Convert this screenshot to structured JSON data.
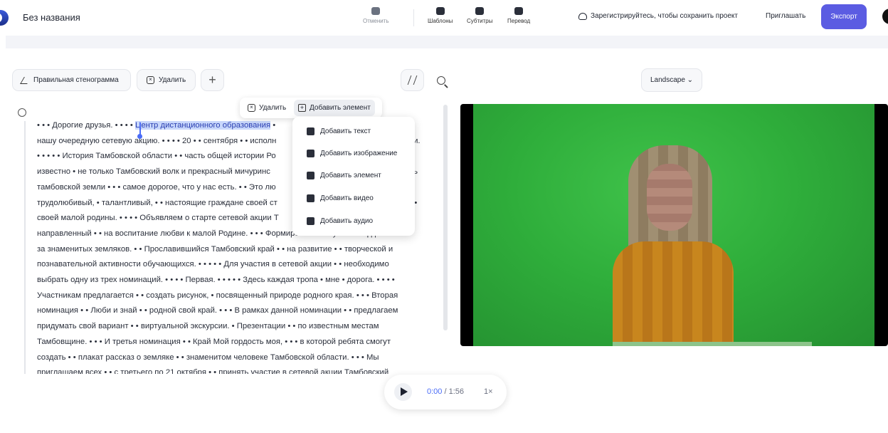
{
  "header": {
    "title": "Без названия",
    "undo_label": "Отменить",
    "templates_label": "Шаблоны",
    "subtitles_label": "Субтитры",
    "translate_label": "Перевод",
    "signup_label": "Зарегистрируйтесь, чтобы сохранить проект",
    "invite_label": "Приглашать",
    "export_label": "Экспорт",
    "accent_color": "#5b5ce2"
  },
  "toolbar": {
    "transcript_label": "Правильная стенограмма",
    "delete_label": "Удалить",
    "plus_label": "+",
    "aspect_label": "Landscape ⌄"
  },
  "context_menu": {
    "delete_label": "Удалить",
    "add_element_label": "Добавить элемент",
    "items": [
      {
        "label": "Добавить текст",
        "icon": "text-icon"
      },
      {
        "label": "Добавить изображение",
        "icon": "image-icon"
      },
      {
        "label": "Добавить элемент",
        "icon": "element-icon"
      },
      {
        "label": "Добавить видео",
        "icon": "video-icon"
      },
      {
        "label": "Добавить аудио",
        "icon": "audio-icon"
      }
    ]
  },
  "transcript": {
    "lines": [
      {
        "pre": "• • • Дорогие друзья. • • • • ",
        "hl": "Центр дистанционного образования",
        "post": " •",
        "tail": "а"
      },
      {
        "pre": "нашу очередную сетевую акцию. • • • • 20 • • сентября • • исполн",
        "hl": "",
        "post": "",
        "tail": "асти."
      },
      {
        "pre": "• • • • • История Тамбовской области • • часть общей истории Ро",
        "hl": "",
        "post": "",
        "tail": ""
      },
      {
        "pre": "известно • не только Тамбовский волк и прекрасный мичуринс",
        "hl": "",
        "post": "",
        "tail": "ость"
      },
      {
        "pre": "тамбовской земли • • • самое дорогое, что у нас есть. • • Это лю",
        "hl": "",
        "post": "",
        "tail": "•"
      },
      {
        "pre": "трудолюбивый, • талантливый, • • настоящие граждане своей ст",
        "hl": "",
        "post": "",
        "tail": "ы • •"
      },
      {
        "pre": "своей малой родины. • • • • Объявляем о старте сетевой акции Т",
        "hl": "",
        "post": "",
        "tail": ""
      },
      {
        "pre": "направленный • • на воспитание любви к малой Родине. • • • Формирование • чувства гордости • •",
        "hl": "",
        "post": "",
        "tail": ""
      },
      {
        "pre": "за знаменитых земляков. • • Прославившийся Тамбовский край • • на развитие • • творческой и",
        "hl": "",
        "post": "",
        "tail": ""
      },
      {
        "pre": "познавательной активности обучающихся. • • • • • Для участия в сетевой акции • • необходимо",
        "hl": "",
        "post": "",
        "tail": ""
      },
      {
        "pre": "выбрать одну из трех номинаций. • • • • Первая. • • • • • Здесь каждая тропа • мне • дорога. • • • •",
        "hl": "",
        "post": "",
        "tail": ""
      },
      {
        "pre": "Участникам предлагается • • создать рисунок, • посвященный природе родного края. • • • Вторая",
        "hl": "",
        "post": "",
        "tail": ""
      },
      {
        "pre": "номинация • • Люби и знай • • родной свой край. • • • В рамках данной номинации • • предлагаем",
        "hl": "",
        "post": "",
        "tail": ""
      },
      {
        "pre": "придумать свой вариант • • виртуальной экскурсии. • Презентации • • по известным местам",
        "hl": "",
        "post": "",
        "tail": ""
      },
      {
        "pre": "Тамбовщине. • • • И третья номинация • • Край Мой гордость моя, • • • в которой ребята смогут",
        "hl": "",
        "post": "",
        "tail": ""
      },
      {
        "pre": "создать • • плакат рассказ о земляке • • знаменитом человеке Тамбовской области. • • • Мы",
        "hl": "",
        "post": "",
        "tail": ""
      },
      {
        "pre": "приглашаем всех • • с третьего по 21 октября • • принять участие в сетевой акции Тамбовский",
        "hl": "",
        "post": "",
        "tail": ""
      }
    ]
  },
  "player": {
    "current_time": "0:00",
    "separator": "/",
    "total_time": "1:56",
    "speed": "1×"
  }
}
